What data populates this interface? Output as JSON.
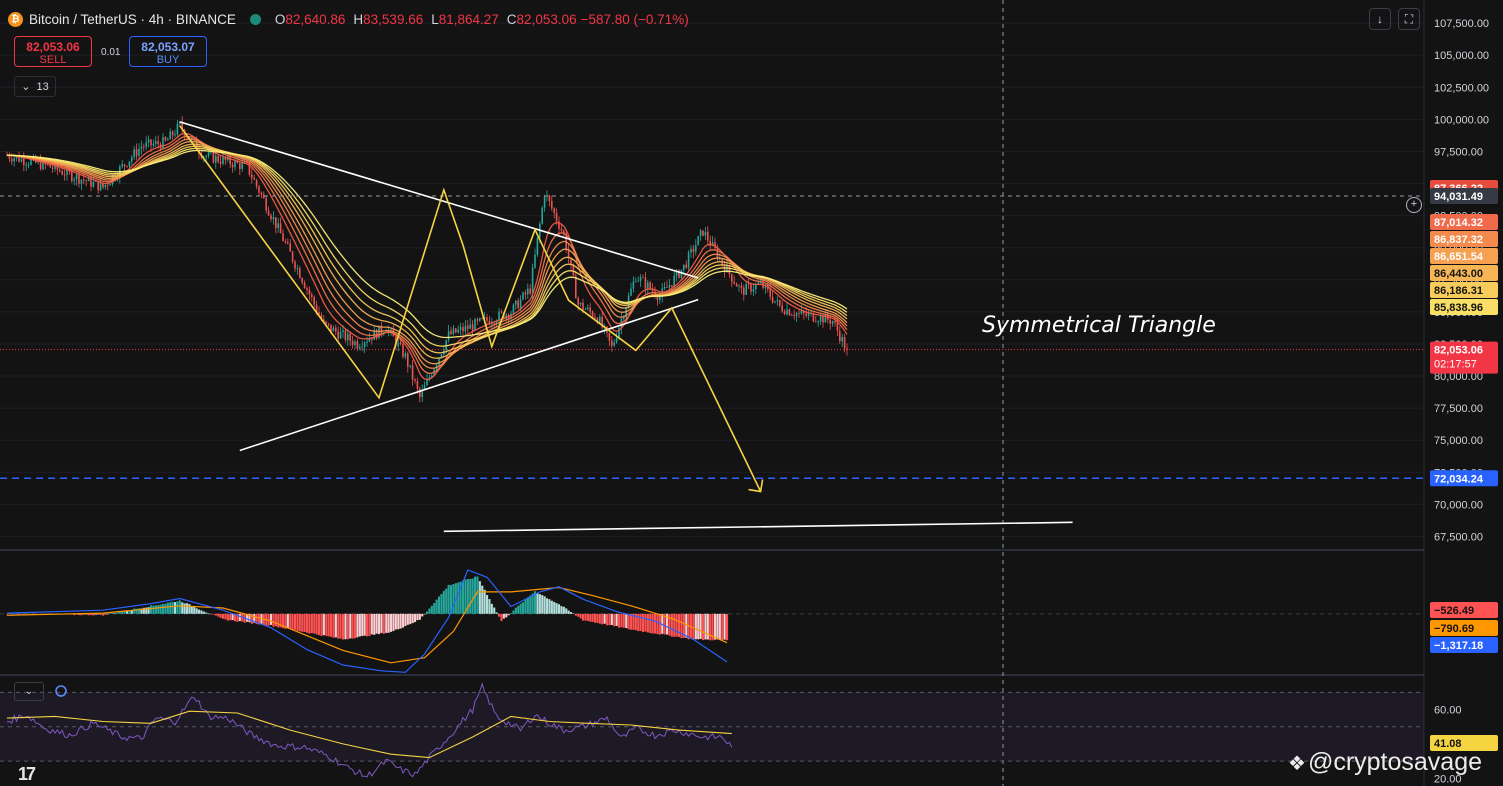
{
  "header": {
    "symbol": "Bitcoin / TetherUS · 4h · BINANCE",
    "coin_glyph": "₿",
    "open_label": "O",
    "open": "82,640.86",
    "high_label": "H",
    "high": "83,539.66",
    "low_label": "L",
    "low": "81,864.27",
    "close_label": "C",
    "close": "82,053.06",
    "change": "−587.80 (−0.71%)"
  },
  "trade": {
    "sell_price": "82,053.06",
    "sell_label": "SELL",
    "buy_price": "82,053.07",
    "buy_label": "BUY",
    "spread": "0.01"
  },
  "indicators_toggle": {
    "count": "13",
    "chevron": "⌄"
  },
  "toolbar": {
    "download_glyph": "↓",
    "fullscreen_glyph": "⛶",
    "plus_glyph": "+"
  },
  "watermark": {
    "text": "@cryptosavage",
    "icon": "❖"
  },
  "tv_logo": "17",
  "colors": {
    "background": "#131313",
    "bull": "#26a69a",
    "bear": "#ef5350",
    "pattern": "#f5d442",
    "trendline": "#ffffff",
    "target": "#2962ff",
    "macd_line": "#2962ff",
    "signal_line": "#ff9800",
    "rsi_line": "#7e57c2",
    "rsi_ma": "#f5d442"
  },
  "chart_data": [
    {
      "type": "candlestick",
      "pane": "price",
      "x_unit": "4h bar index",
      "ylim": [
        66600,
        109300
      ],
      "y_ticks": [
        "107,500.00",
        "105,000.00",
        "102,500.00",
        "100,000.00",
        "97,500.00",
        "95,000.00",
        "92,500.00",
        "90,000.00",
        "87,500.00",
        "85,000.00",
        "82,500.00",
        "80,000.00",
        "77,500.00",
        "75,000.00",
        "72,500.00",
        "70,000.00",
        "67,500.00"
      ],
      "pivots": [
        [
          0,
          97200
        ],
        [
          18,
          96300
        ],
        [
          40,
          94700
        ],
        [
          56,
          97900
        ],
        [
          66,
          98200
        ],
        [
          72,
          99500
        ],
        [
          82,
          97200
        ],
        [
          100,
          96300
        ],
        [
          110,
          92600
        ],
        [
          122,
          88000
        ],
        [
          132,
          84000
        ],
        [
          146,
          82500
        ],
        [
          158,
          83800
        ],
        [
          166,
          81500
        ],
        [
          172,
          78300
        ],
        [
          184,
          83200
        ],
        [
          198,
          84200
        ],
        [
          210,
          85000
        ],
        [
          218,
          86800
        ],
        [
          224,
          94300
        ],
        [
          232,
          91000
        ],
        [
          238,
          85600
        ],
        [
          246,
          84600
        ],
        [
          252,
          82200
        ],
        [
          262,
          87800
        ],
        [
          272,
          86200
        ],
        [
          282,
          88500
        ],
        [
          290,
          91300
        ],
        [
          298,
          88800
        ],
        [
          306,
          86600
        ],
        [
          314,
          87200
        ],
        [
          322,
          85400
        ],
        [
          330,
          84800
        ],
        [
          338,
          84600
        ],
        [
          344,
          84300
        ],
        [
          350,
          82000
        ]
      ],
      "last_close": 82053.06,
      "countdown": "02:17:57",
      "ribbon_colors": [
        "#f05a46",
        "#f2734a",
        "#f48a4e",
        "#f6a052",
        "#f7b656",
        "#f8cc5b",
        "#f9df66",
        "#fbf07a"
      ],
      "ribbon_labels": [
        "87,366.22",
        "87,014.32",
        "86,837.32",
        "86,651.54",
        "86,443.00",
        "86,186.31",
        "85,838.96"
      ],
      "ribbon_label_colors": [
        "#e74c3c",
        "#f06a4c",
        "#f48a4e",
        "#f6a052",
        "#f7b656",
        "#f8cc5b",
        "#f9df66"
      ],
      "crosshair_price": "94,031.49",
      "target_price": "72,034.24",
      "annotations": [
        {
          "type": "text",
          "text": "Symmetrical Triangle"
        },
        {
          "type": "trendline",
          "name": "upper-resistance",
          "points": [
            [
              72,
              99800
            ],
            [
              288,
              87650
            ]
          ]
        },
        {
          "type": "trendline",
          "name": "lower-support",
          "points": [
            [
              97,
              74200
            ],
            [
              288,
              85950
            ]
          ]
        },
        {
          "type": "trendline",
          "name": "long-support",
          "points": [
            [
              182,
              67900
            ],
            [
              444,
              68600
            ]
          ]
        },
        {
          "type": "polyline",
          "name": "swing-pattern",
          "points": [
            [
              72,
              99500
            ],
            [
              155,
              78300
            ],
            [
              182,
              94500
            ],
            [
              190,
              90200
            ],
            [
              202,
              82300
            ],
            [
              220,
              91400
            ],
            [
              234,
              85900
            ],
            [
              262,
              82000
            ],
            [
              277,
              85300
            ],
            [
              314,
              71000
            ]
          ]
        },
        {
          "type": "arrow",
          "name": "target-arrow",
          "points": [
            [
              314,
              71000
            ]
          ]
        }
      ]
    },
    {
      "type": "bar",
      "pane": "macd",
      "ylim": [
        -1620,
        1720
      ],
      "y_ticks": [
        "0.00"
      ],
      "pivots": [
        [
          0,
          0
        ],
        [
          40,
          -30
        ],
        [
          72,
          360
        ],
        [
          90,
          -150
        ],
        [
          110,
          -320
        ],
        [
          140,
          -700
        ],
        [
          160,
          -500
        ],
        [
          172,
          -160
        ],
        [
          184,
          780
        ],
        [
          196,
          1020
        ],
        [
          206,
          -200
        ],
        [
          220,
          620
        ],
        [
          230,
          260
        ],
        [
          240,
          -170
        ],
        [
          260,
          -430
        ],
        [
          286,
          -700
        ],
        [
          300,
          -720
        ]
      ],
      "lines": {
        "macd": [
          [
            0,
            20
          ],
          [
            40,
            100
          ],
          [
            60,
            280
          ],
          [
            72,
            420
          ],
          [
            90,
            100
          ],
          [
            110,
            -380
          ],
          [
            125,
            -980
          ],
          [
            140,
            -1400
          ],
          [
            156,
            -1560
          ],
          [
            166,
            -1600
          ],
          [
            174,
            -1100
          ],
          [
            184,
            -100
          ],
          [
            192,
            1200
          ],
          [
            200,
            1000
          ],
          [
            210,
            200
          ],
          [
            222,
            600
          ],
          [
            230,
            740
          ],
          [
            240,
            400
          ],
          [
            254,
            60
          ],
          [
            270,
            -200
          ],
          [
            286,
            -700
          ],
          [
            300,
            -1317
          ]
        ],
        "signal": [
          [
            0,
            -40
          ],
          [
            40,
            20
          ],
          [
            72,
            220
          ],
          [
            90,
            160
          ],
          [
            110,
            -200
          ],
          [
            125,
            -600
          ],
          [
            140,
            -1000
          ],
          [
            160,
            -1340
          ],
          [
            174,
            -1200
          ],
          [
            186,
            -480
          ],
          [
            196,
            600
          ],
          [
            210,
            600
          ],
          [
            230,
            720
          ],
          [
            244,
            500
          ],
          [
            260,
            220
          ],
          [
            278,
            -150
          ],
          [
            300,
            -791
          ]
        ]
      },
      "last_values": {
        "histogram": "−526.49",
        "signal": "−790.69",
        "macd": "−1,317.18"
      }
    },
    {
      "type": "line",
      "pane": "rsi",
      "ylim": [
        15.5,
        79.5
      ],
      "y_ticks": [
        "60.00",
        "20.00"
      ],
      "bands": [
        70,
        50,
        30
      ],
      "pivots": [
        [
          0,
          53
        ],
        [
          8,
          57
        ],
        [
          16,
          49
        ],
        [
          26,
          45
        ],
        [
          36,
          52
        ],
        [
          48,
          44
        ],
        [
          56,
          43
        ],
        [
          62,
          55
        ],
        [
          70,
          53
        ],
        [
          78,
          68
        ],
        [
          84,
          56
        ],
        [
          92,
          55
        ],
        [
          102,
          45
        ],
        [
          112,
          39
        ],
        [
          124,
          38
        ],
        [
          134,
          33
        ],
        [
          142,
          26
        ],
        [
          150,
          21
        ],
        [
          158,
          30
        ],
        [
          164,
          25
        ],
        [
          170,
          22
        ],
        [
          176,
          32
        ],
        [
          184,
          44
        ],
        [
          194,
          60
        ],
        [
          198,
          73
        ],
        [
          204,
          56
        ],
        [
          214,
          48
        ],
        [
          220,
          57
        ],
        [
          226,
          52
        ],
        [
          232,
          48
        ],
        [
          240,
          50
        ],
        [
          250,
          55
        ],
        [
          256,
          43
        ],
        [
          262,
          49
        ],
        [
          270,
          45
        ],
        [
          278,
          48
        ],
        [
          290,
          44
        ],
        [
          298,
          44
        ],
        [
          302,
          38
        ]
      ],
      "ma": [
        [
          0,
          55
        ],
        [
          20,
          56
        ],
        [
          40,
          53
        ],
        [
          60,
          52
        ],
        [
          76,
          59
        ],
        [
          96,
          58
        ],
        [
          118,
          48
        ],
        [
          140,
          40
        ],
        [
          160,
          34
        ],
        [
          176,
          32
        ],
        [
          194,
          44
        ],
        [
          210,
          56
        ],
        [
          226,
          53
        ],
        [
          242,
          52
        ],
        [
          260,
          51
        ],
        [
          280,
          48
        ],
        [
          302,
          46
        ]
      ],
      "last_value": "41.08"
    }
  ]
}
